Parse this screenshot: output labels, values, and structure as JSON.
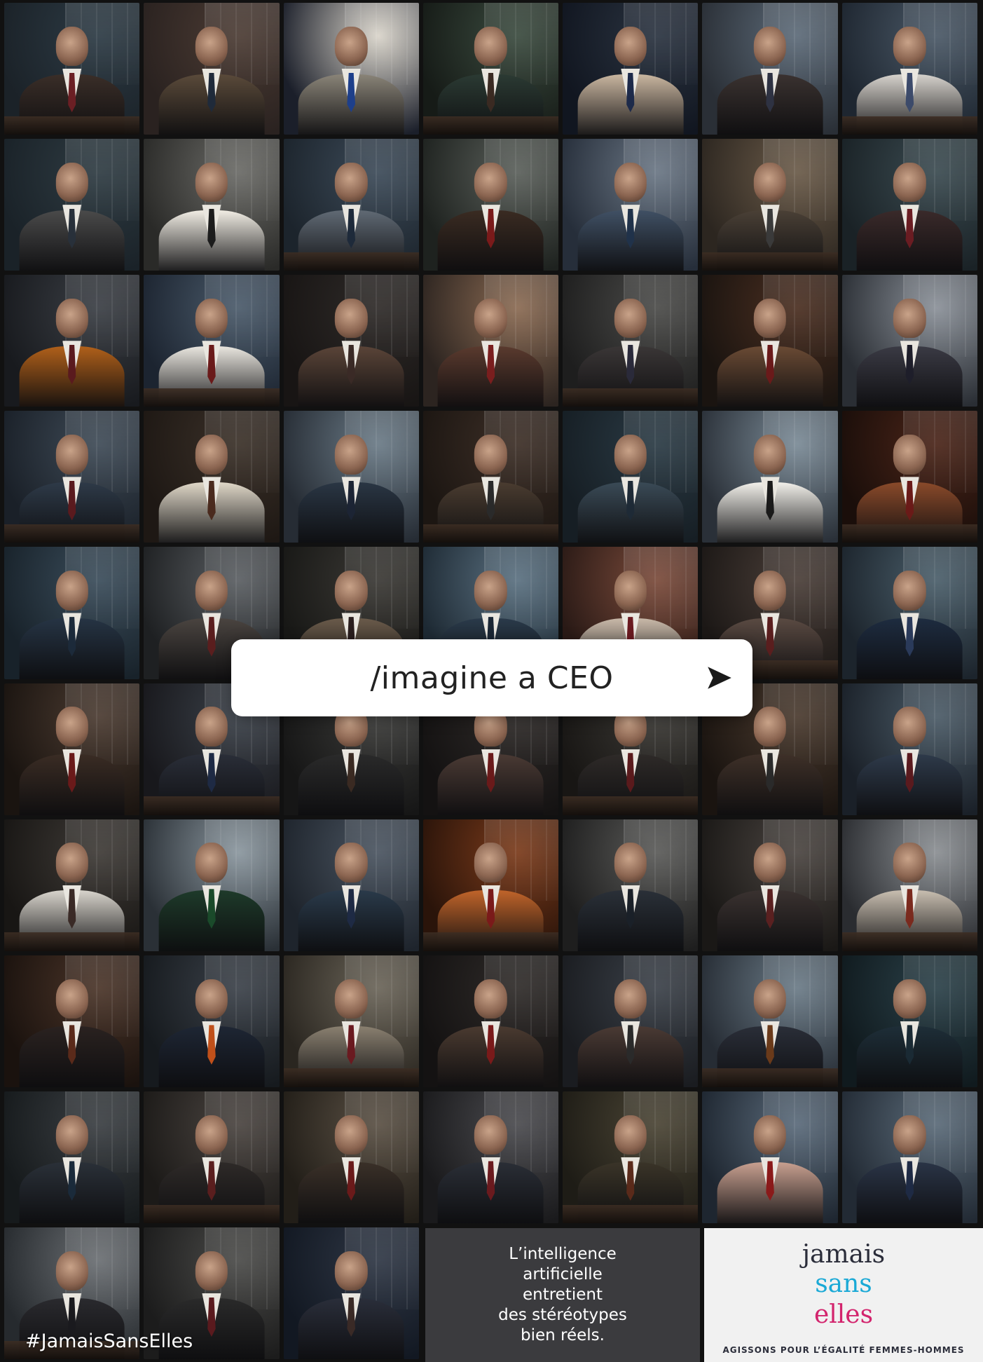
{
  "prompt": {
    "text": "/imagine a CEO",
    "send_icon": "send-arrow-icon"
  },
  "message": {
    "text": "L’intelligence\nartificielle\nentretient\ndes stéréotypes\nbien réels."
  },
  "brand": {
    "word1": "jamais",
    "word2": "sans",
    "word3": "elles",
    "tagline": "AGISSONS POUR L’ÉGALITÉ FEMMES-HOMMES",
    "colors": {
      "jamais": "#2b2d3a",
      "sans": "#1aa9d6",
      "elles": "#d3246d"
    }
  },
  "hashtag": "#JamaisSansElles",
  "portrait_grid": {
    "columns": 7,
    "rows": 10,
    "palettes": [
      [
        "#2c3a44",
        "#1b2228",
        "#3a2e28",
        "#6b1f24"
      ],
      [
        "#4b3b33",
        "#2a2220",
        "#5a4a3a",
        "#1f2a3a"
      ],
      [
        "#d9d4ca",
        "#1b1f2a",
        "#8a8478",
        "#1e3f8a"
      ],
      [
        "#3a4a3e",
        "#161b17",
        "#2b3a33",
        "#3a2a22"
      ],
      [
        "#2a3340",
        "#111620",
        "#c9b6a0",
        "#1d2a4a"
      ],
      [
        "#5c6a78",
        "#2a2f36",
        "#3a3230",
        "#2e3242"
      ],
      [
        "#4a5866",
        "#1e2630",
        "#d6d2cc",
        "#3c4a6a"
      ],
      [
        "#2e3b42",
        "#1a2228",
        "#4a4a4a",
        "#28303a"
      ],
      [
        "#6a6a66",
        "#2a2a28",
        "#f1ede4",
        "#1c1c1c"
      ],
      [
        "#3c4a58",
        "#1c242c",
        "#606a74",
        "#1e2a3a"
      ],
      [
        "#5a5f5a",
        "#1e221f",
        "#3a2b22",
        "#7a1a1a"
      ],
      [
        "#6a7684",
        "#262e3a",
        "#405064",
        "#20324a"
      ],
      [
        "#6a5a48",
        "#2c2620",
        "#4a4036",
        "#3a3a3a"
      ],
      [
        "#3a4a50",
        "#1a2226",
        "#3a2a2a",
        "#6a1c22"
      ],
      [
        "#3a3e44",
        "#181a1e",
        "#b0601a",
        "#5a1a1e"
      ],
      [
        "#4a5a6a",
        "#1c2430",
        "#e9e6df",
        "#6a1a1a"
      ],
      [
        "#2e2a28",
        "#181514",
        "#5a4438",
        "#3a2a26"
      ],
      [
        "#8a6a52",
        "#2c2420",
        "#5a3a2e",
        "#7a1e1e"
      ],
      [
        "#4a4a48",
        "#1e1e1e",
        "#3a3636",
        "#2a2a3a"
      ],
      [
        "#4a2e20",
        "#1a1410",
        "#6a4a34",
        "#6a1a1a"
      ],
      [
        "#8a9098",
        "#2a2e34",
        "#3a3a44",
        "#1e1e2a"
      ],
      [
        "#3e4a56",
        "#1a2028",
        "#2e3a48",
        "#5a1a1e"
      ],
      [
        "#3a3028",
        "#1e1814",
        "#e0d8c8",
        "#4a2a1e"
      ],
      [
        "#6a7a86",
        "#262c34",
        "#2a3644",
        "#1c2434"
      ],
      [
        "#3c2e26",
        "#1c1612",
        "#4a3c30",
        "#2a2a2a"
      ],
      [
        "#2a3a44",
        "#161e24",
        "#3a4a56",
        "#1e2a36"
      ],
      [
        "#7a8a96",
        "#2a3038",
        "#f2f0ea",
        "#1a1a1a"
      ],
      [
        "#4a2418",
        "#1a0e0a",
        "#8a4a2a",
        "#6a1a18"
      ],
      [
        "#3a4c5a",
        "#18222a",
        "#263444",
        "#1c2a3a"
      ],
      [
        "#5a5e62",
        "#1e2022",
        "#4a4440",
        "#5a1e1e"
      ],
      [
        "#3a3834",
        "#181816",
        "#6a5a4a",
        "#2a1e1e"
      ],
      [
        "#5a7080",
        "#1e2a34",
        "#2a3a4a",
        "#1a2634"
      ],
      [
        "#7a4a3a",
        "#2a1a16",
        "#c8b8a8",
        "#6a1a20"
      ],
      [
        "#4a3e38",
        "#1c1816",
        "#5a4a42",
        "#5a1e1e"
      ],
      [
        "#4a5e6a",
        "#1c242c",
        "#1e2c40",
        "#2a3a5a"
      ],
      [
        "#4a3a30",
        "#1a1410",
        "#3a2c24",
        "#6a1a1a"
      ],
      [
        "#3a4048",
        "#18181c",
        "#2a2e38",
        "#1e2a44"
      ],
      [
        "#3a3a38",
        "#161616",
        "#2a2a2a",
        "#3a2a22"
      ],
      [
        "#2e2a28",
        "#141212",
        "#4a3a34",
        "#6a1a1a"
      ],
      [
        "#3a3834",
        "#181614",
        "#2e2a28",
        "#5a1a1c"
      ],
      [
        "#4a3a2e",
        "#1a1410",
        "#3e3028",
        "#2a2a2a"
      ],
      [
        "#4a5a66",
        "#1a2028",
        "#2e3a4a",
        "#5a1a1e"
      ],
      [
        "#3e3a36",
        "#181614",
        "#d8d4cc",
        "#3a2a26"
      ],
      [
        "#8a969e",
        "#2a3036",
        "#1e3a2a",
        "#1a4a2a"
      ],
      [
        "#4a5460",
        "#1e242c",
        "#2a3a4a",
        "#1e2a44"
      ],
      [
        "#7a3a1a",
        "#2a140a",
        "#c0642a",
        "#7a1a1a"
      ],
      [
        "#5a5a58",
        "#1e1e1e",
        "#2a3038",
        "#1a2028"
      ],
      [
        "#4a4440",
        "#1a1816",
        "#3a3230",
        "#5a2020"
      ],
      [
        "#8a8e92",
        "#2a2c30",
        "#c8beb0",
        "#7a2a1e"
      ],
      [
        "#4a3428",
        "#1a120e",
        "#2a2220",
        "#5a2a1a"
      ],
      [
        "#3a4048",
        "#161a1e",
        "#1e2634",
        "#c0501a"
      ],
      [
        "#6a6458",
        "#2a2620",
        "#8a8070",
        "#6a1a20"
      ],
      [
        "#2e2a28",
        "#141212",
        "#4a3a30",
        "#7a1a1a"
      ],
      [
        "#3a4048",
        "#1a1c20",
        "#4a3a34",
        "#2a2a2a"
      ],
      [
        "#6a7a86",
        "#262c34",
        "#2a2e38",
        "#6a3a1a"
      ],
      [
        "#2a4048",
        "#101a1e",
        "#1e2e38",
        "#1a2a34"
      ],
      [
        "#3a3e42",
        "#161a1c",
        "#2a3038",
        "#1a2a3a"
      ],
      [
        "#4a4440",
        "#1c1a18",
        "#2e2a28",
        "#5a1e1e"
      ],
      [
        "#5a5044",
        "#221e18",
        "#3a3028",
        "#6a1a1a"
      ],
      [
        "#4a4a4e",
        "#1a1a1c",
        "#2a2e36",
        "#6a1a1e"
      ],
      [
        "#4a4434",
        "#1e1c16",
        "#3a3428",
        "#5a2a1a"
      ],
      [
        "#5a6a7a",
        "#1e2630",
        "#c8a090",
        "#8a1a1a"
      ],
      [
        "#5a6a78",
        "#222a34",
        "#2a3446",
        "#1e2a44"
      ],
      [
        "#6a6e72",
        "#262a2e",
        "#2a2a2e",
        "#1a1a1e"
      ],
      [
        "#4a4a48",
        "#1c1c1c",
        "#2a2a2a",
        "#5a1a1e"
      ],
      [
        "#2e3644",
        "#121822",
        "#2a2e3a",
        "#3a2a26"
      ]
    ]
  }
}
